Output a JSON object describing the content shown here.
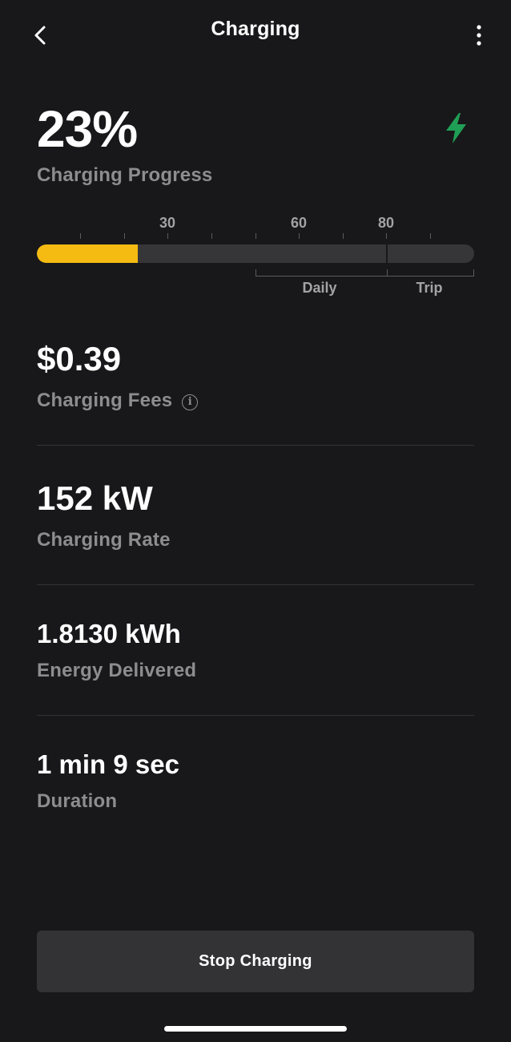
{
  "header": {
    "title": "Charging",
    "back_icon": "chevron-left-icon",
    "menu_icon": "more-vertical-icon"
  },
  "progress": {
    "value": "23%",
    "label": "Charging Progress",
    "status_icon": "lightning-bolt-icon",
    "status_color": "#1f9f55",
    "fill_fraction": 0.23,
    "limit_fraction": 0.8,
    "fill_color": "#f6bb12",
    "scale_labels": [
      "30",
      "60",
      "80"
    ],
    "ranges": [
      "Daily",
      "Trip"
    ]
  },
  "stats": {
    "fees": {
      "value": "$0.39",
      "label": "Charging Fees",
      "info_icon": "info-circle-icon",
      "info_glyph": "i"
    },
    "rate": {
      "value": "152 kW",
      "label": "Charging Rate"
    },
    "energy": {
      "value": "1.8130 kWh",
      "label": "Energy Delivered"
    },
    "duration": {
      "value": "1 min 9 sec",
      "label": "Duration"
    }
  },
  "actions": {
    "stop_label": "Stop Charging"
  }
}
